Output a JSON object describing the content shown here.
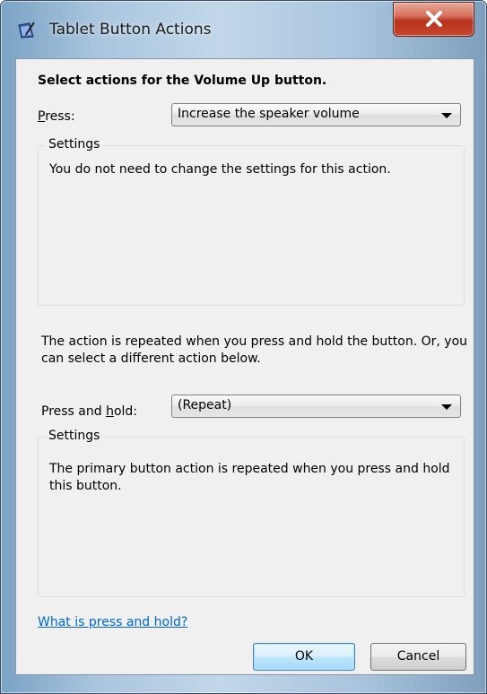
{
  "window": {
    "title": "Tablet Button Actions"
  },
  "dialog": {
    "heading": "Select actions for the Volume Up button.",
    "press": {
      "label_accel": "P",
      "label_rest": "ress:",
      "selected_value": "Increase the speaker volume"
    },
    "press_settings": {
      "title": "Settings",
      "text": "You do not need to change the settings for this action."
    },
    "repeat_description": "The action is repeated when you press and hold the button. Or, you can select a different action below.",
    "press_hold": {
      "label_before": "Press and ",
      "label_accel": "h",
      "label_after": "old:",
      "selected_value": "(Repeat)"
    },
    "hold_settings": {
      "title": "Settings",
      "text": "The primary button action is repeated when you press and hold this button."
    },
    "help_link": "What is press and hold?",
    "ok_label": "OK",
    "cancel_label": "Cancel"
  },
  "colors": {
    "link": "#0066cc",
    "dialog_background": "#f0f0f0",
    "close_button": "#c8472d"
  },
  "icons": [
    "tablet-pen-icon",
    "close-icon",
    "dropdown-arrow-icon"
  ]
}
